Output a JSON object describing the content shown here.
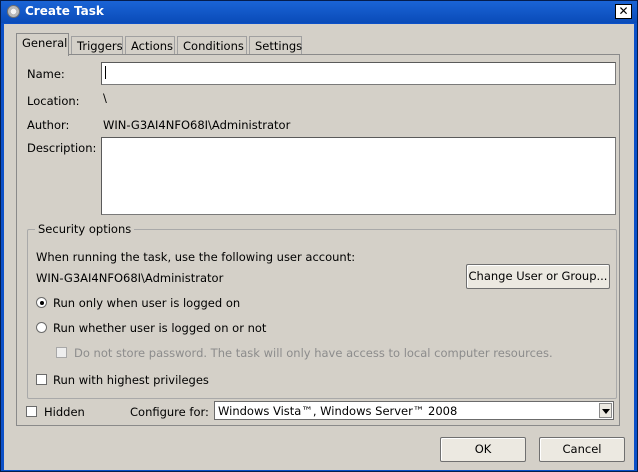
{
  "window": {
    "title": "Create Task",
    "close_glyph": "✕",
    "icon": "task-scheduler-icon"
  },
  "tabs": [
    {
      "label": "General",
      "active": true
    },
    {
      "label": "Triggers",
      "active": false
    },
    {
      "label": "Actions",
      "active": false
    },
    {
      "label": "Conditions",
      "active": false
    },
    {
      "label": "Settings",
      "active": false
    }
  ],
  "general": {
    "name_label": "Name:",
    "name_value": "",
    "location_label": "Location:",
    "location_value": "\\",
    "author_label": "Author:",
    "author_value": "WIN-G3AI4NFO68I\\Administrator",
    "description_label": "Description:",
    "description_value": ""
  },
  "security": {
    "title": "Security options",
    "account_prompt": "When running the task, use the following user account:",
    "account": "WIN-G3AI4NFO68I\\Administrator",
    "change_button": "Change User or Group...",
    "run_logged_on": "Run only when user is logged on",
    "run_logged_on_selected": true,
    "run_whether": "Run whether user is logged on or not",
    "run_whether_selected": false,
    "no_store_password": "Do not store password.  The task will only have access to local computer resources.",
    "highest_privileges": "Run with highest privileges",
    "highest_privileges_checked": false
  },
  "footer": {
    "hidden_label": "Hidden",
    "hidden_checked": false,
    "configure_label": "Configure for:",
    "configure_value": "Windows Vista™, Windows Server™ 2008"
  },
  "buttons": {
    "ok": "OK",
    "cancel": "Cancel"
  }
}
